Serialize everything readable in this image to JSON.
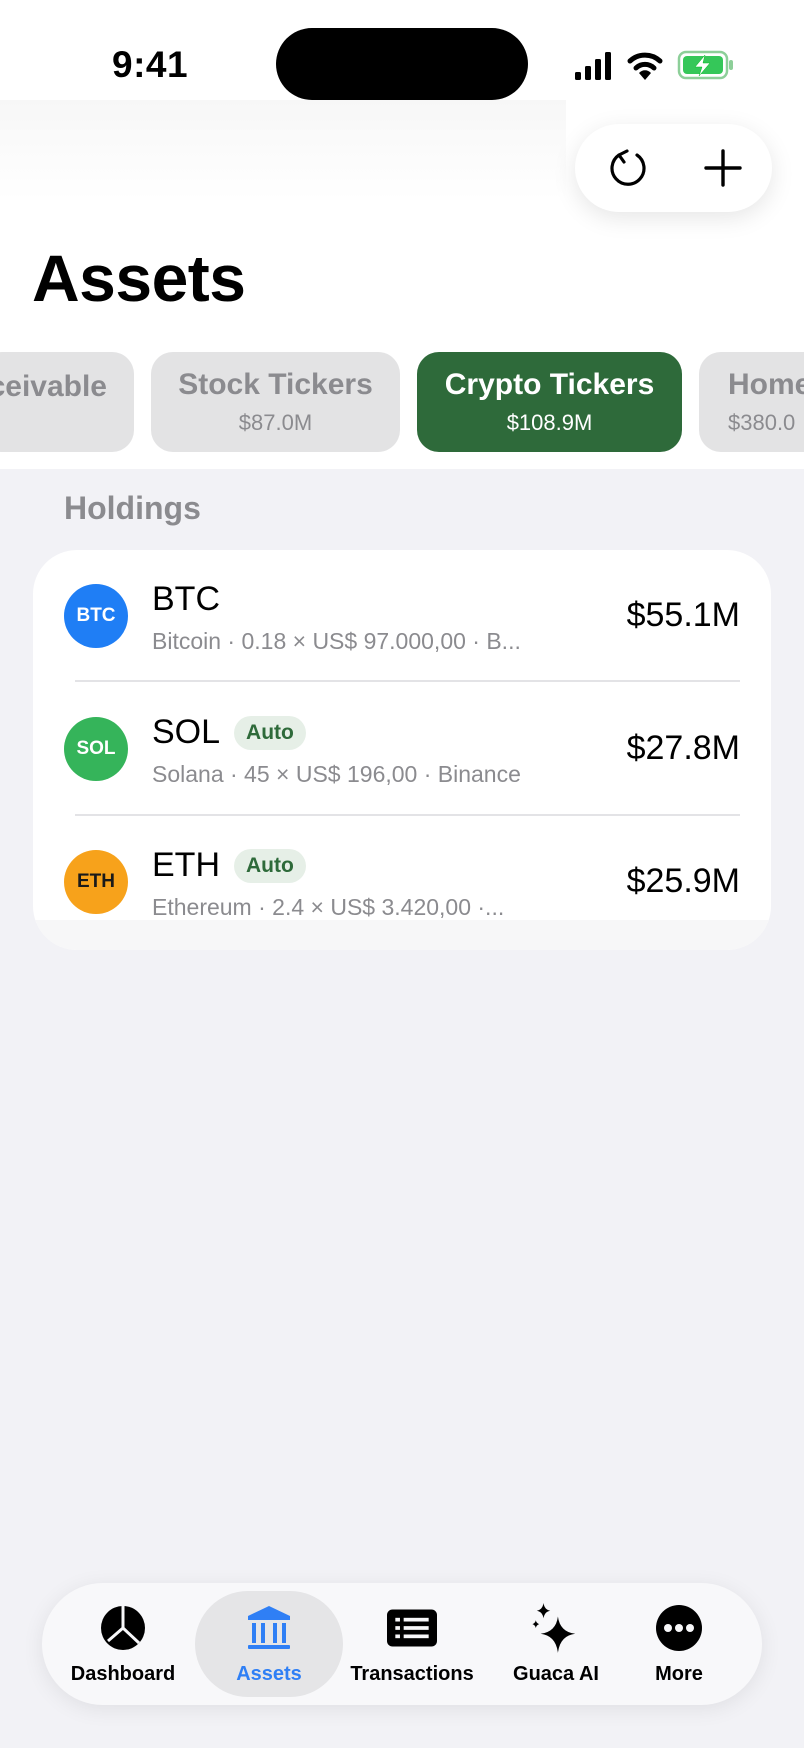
{
  "status_bar": {
    "time": "9:41"
  },
  "header": {
    "title": "Assets",
    "refresh_icon": "refresh-icon",
    "add_icon": "plus-icon"
  },
  "categories": [
    {
      "label": "ceivable",
      "value": ""
    },
    {
      "label": "Stock Tickers",
      "value": "$87.0M"
    },
    {
      "label": "Crypto Tickers",
      "value": "$108.9M",
      "selected": true
    },
    {
      "label": "Home",
      "value": "$380.0"
    }
  ],
  "holdings": {
    "section_label": "Holdings",
    "items": [
      {
        "symbol": "BTC",
        "avatar_text": "BTC",
        "color": "#1f7ef5",
        "detail": "Bitcoin · 0.18 × US$ 97.000,00 · B...",
        "amount": "$55.1M"
      },
      {
        "symbol": "SOL",
        "avatar_text": "SOL",
        "color": "#35b45a",
        "badge": "Auto",
        "detail": "Solana · 45 × US$ 196,00 · Binance",
        "amount": "$27.8M"
      },
      {
        "symbol": "ETH",
        "avatar_text": "ETH",
        "color": "#f7a21b",
        "badge": "Auto",
        "detail": "Ethereum · 2.4 × US$ 3.420,00 ·...",
        "amount": "$25.9M"
      }
    ]
  },
  "tabbar": {
    "items": [
      {
        "label": "Dashboard",
        "icon": "pie-chart-icon"
      },
      {
        "label": "Assets",
        "icon": "bank-icon",
        "active": true
      },
      {
        "label": "Transactions",
        "icon": "list-icon"
      },
      {
        "label": "Guaca AI",
        "icon": "sparkles-icon"
      },
      {
        "label": "More",
        "icon": "ellipsis-icon"
      }
    ]
  },
  "colors": {
    "accent_green": "#2e6a3a",
    "tab_active_blue": "#2f7ff5",
    "background": "#f2f2f6"
  }
}
